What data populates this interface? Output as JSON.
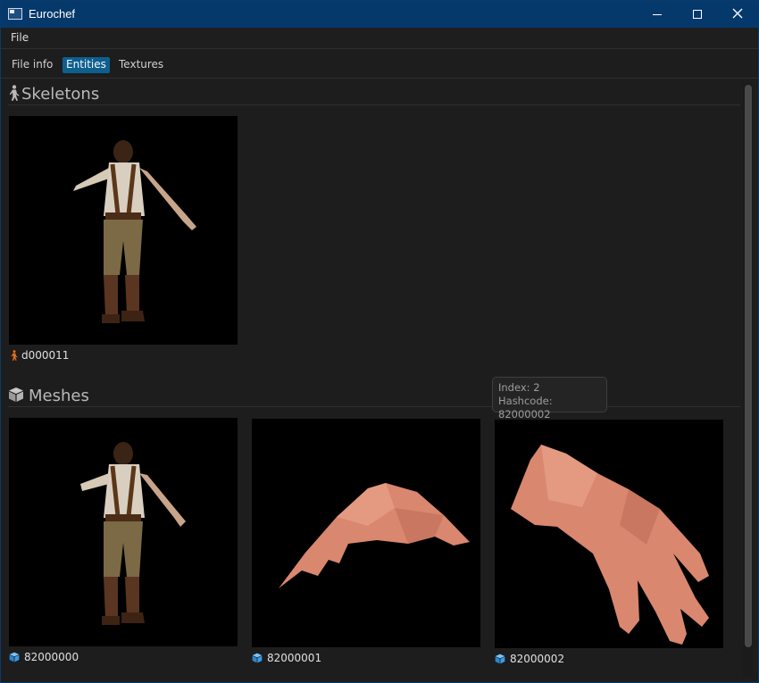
{
  "window": {
    "title": "Eurochef"
  },
  "menubar": {
    "file_label": "File"
  },
  "tabs": [
    {
      "label": "File info",
      "active": false
    },
    {
      "label": "Entities",
      "active": true
    },
    {
      "label": "Textures",
      "active": false
    }
  ],
  "skeletons": {
    "title": "Skeletons",
    "items": [
      {
        "label": "d000011",
        "icon": "skeleton-icon"
      }
    ]
  },
  "meshes": {
    "title": "Meshes",
    "items": [
      {
        "label": "82000000",
        "icon": "mesh-icon"
      },
      {
        "label": "82000001",
        "icon": "mesh-icon"
      },
      {
        "label": "82000002",
        "icon": "mesh-icon"
      }
    ]
  },
  "tooltip": {
    "index_text": "Index: 2",
    "hashcode_text": "Hashcode: 82000002"
  },
  "colors": {
    "accent": "#0e5f8e",
    "titlebar": "#05396b",
    "skeleton_icon": "#e8711f",
    "mesh_icon": "#3a9be6"
  }
}
